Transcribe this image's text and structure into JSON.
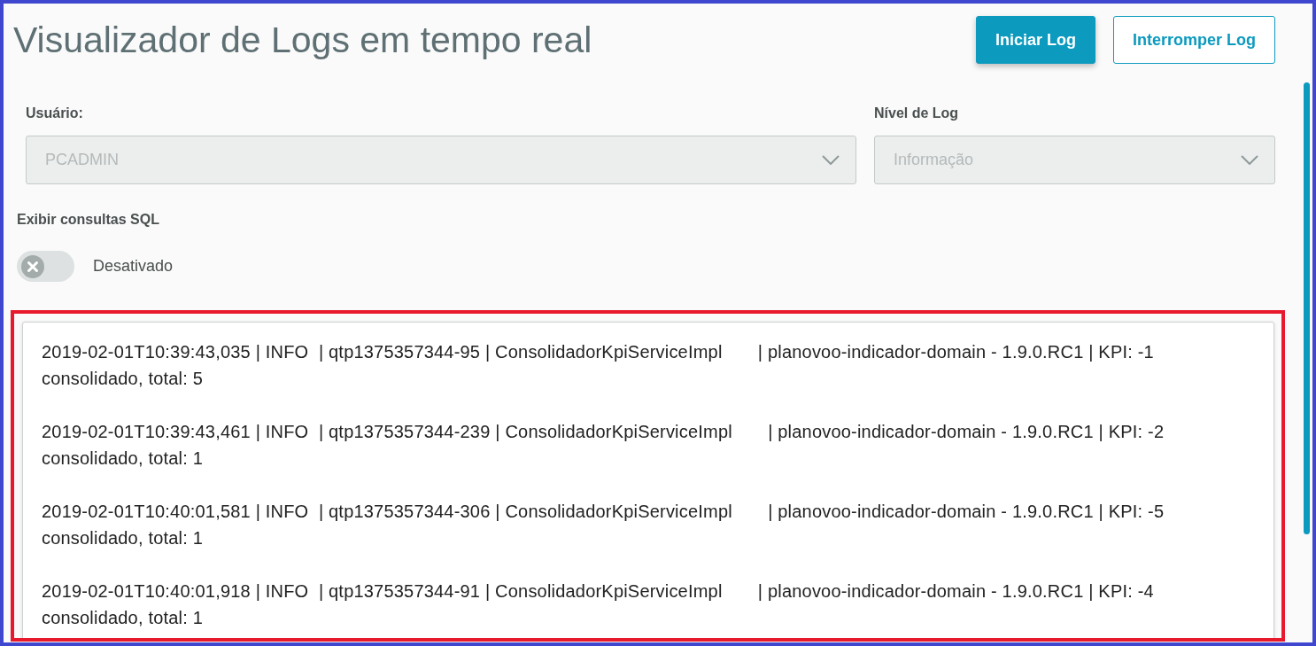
{
  "header": {
    "title": "Visualizador de Logs em tempo real",
    "buttons": [
      {
        "label": "Iniciar Log",
        "kind": "primary"
      },
      {
        "label": "Interromper Log",
        "kind": "outline"
      }
    ]
  },
  "filters": [
    {
      "label": "Usuário:",
      "value": "PCADMIN",
      "disabled": true
    },
    {
      "label": "Nível de Log",
      "value": "Informação",
      "disabled": true
    }
  ],
  "sql_toggle": {
    "label": "Exibir consultas SQL",
    "on": false,
    "state_label": "Desativado"
  },
  "log_panel": {
    "highlighted": true,
    "entries": [
      "2019-02-01T10:39:43,035 | INFO  | qtp1375357344-95 | ConsolidadorKpiServiceImpl       | planovoo-indicador-domain - 1.9.0.RC1 | KPI: -1 consolidado, total: 5",
      "2019-02-01T10:39:43,461 | INFO  | qtp1375357344-239 | ConsolidadorKpiServiceImpl       | planovoo-indicador-domain - 1.9.0.RC1 | KPI: -2 consolidado, total: 1",
      "2019-02-01T10:40:01,581 | INFO  | qtp1375357344-306 | ConsolidadorKpiServiceImpl       | planovoo-indicador-domain - 1.9.0.RC1 | KPI: -5 consolidado, total: 1",
      "2019-02-01T10:40:01,918 | INFO  | qtp1375357344-91 | ConsolidadorKpiServiceImpl       | planovoo-indicador-domain - 1.9.0.RC1 | KPI: -4 consolidado, total: 1"
    ]
  }
}
